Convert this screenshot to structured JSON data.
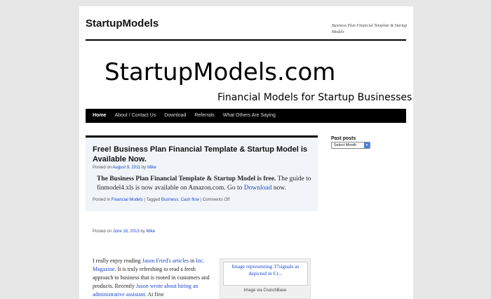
{
  "site": {
    "title": "StartupModels",
    "description": "Business Plan Financial Template & Startup Models"
  },
  "banner": {
    "main_text": "StartupModels.com",
    "sub_text": "Financial Models for Startup Businesses"
  },
  "nav": {
    "items": [
      "Home",
      "About / Contact Us",
      "Download",
      "Referrals",
      "What Others Are Saying"
    ]
  },
  "sticky_post": {
    "title": "Free! Business Plan Financial Template & Startup Model is Available Now.",
    "posted_on": "Posted on",
    "date": "August 9, 2011",
    "by": "by",
    "author": "Mike",
    "body_bold": "The Business Plan Financial Template & Startup Model is free.",
    "body_text": "  The guide to finmodel4.xls is now available on Amazon.com.  Go to ",
    "body_link": "Download",
    "body_end": " now.",
    "posted_in": "Posted in",
    "category": "Financial Models",
    "tagged": "| Tagged",
    "tag1": "Business",
    "tag_sep": ",",
    "tag2": "Cash flow",
    "comments": "| Comments Off"
  },
  "sidebar": {
    "title": "Past posts",
    "select_value": "Select Month"
  },
  "post2": {
    "posted_on": "Posted on",
    "date": "June 16, 2013",
    "by": "by",
    "author": "Mike",
    "t1": "I really enjoy reading ",
    "l1": "Jason Fried's articles",
    "t2": " in ",
    "l2": "Inc. Magazine",
    "t3": ".  It is truly refreshing to read a fresh approach to business that is rooted in customers and products.  Recently ",
    "l3": "Jason wrote about hiring an administrative assistant",
    "t4": ".  At first",
    "image_alt": "Image representing 37signals as depicted in Cr...",
    "image_caption": "Image via CrunchBase"
  }
}
